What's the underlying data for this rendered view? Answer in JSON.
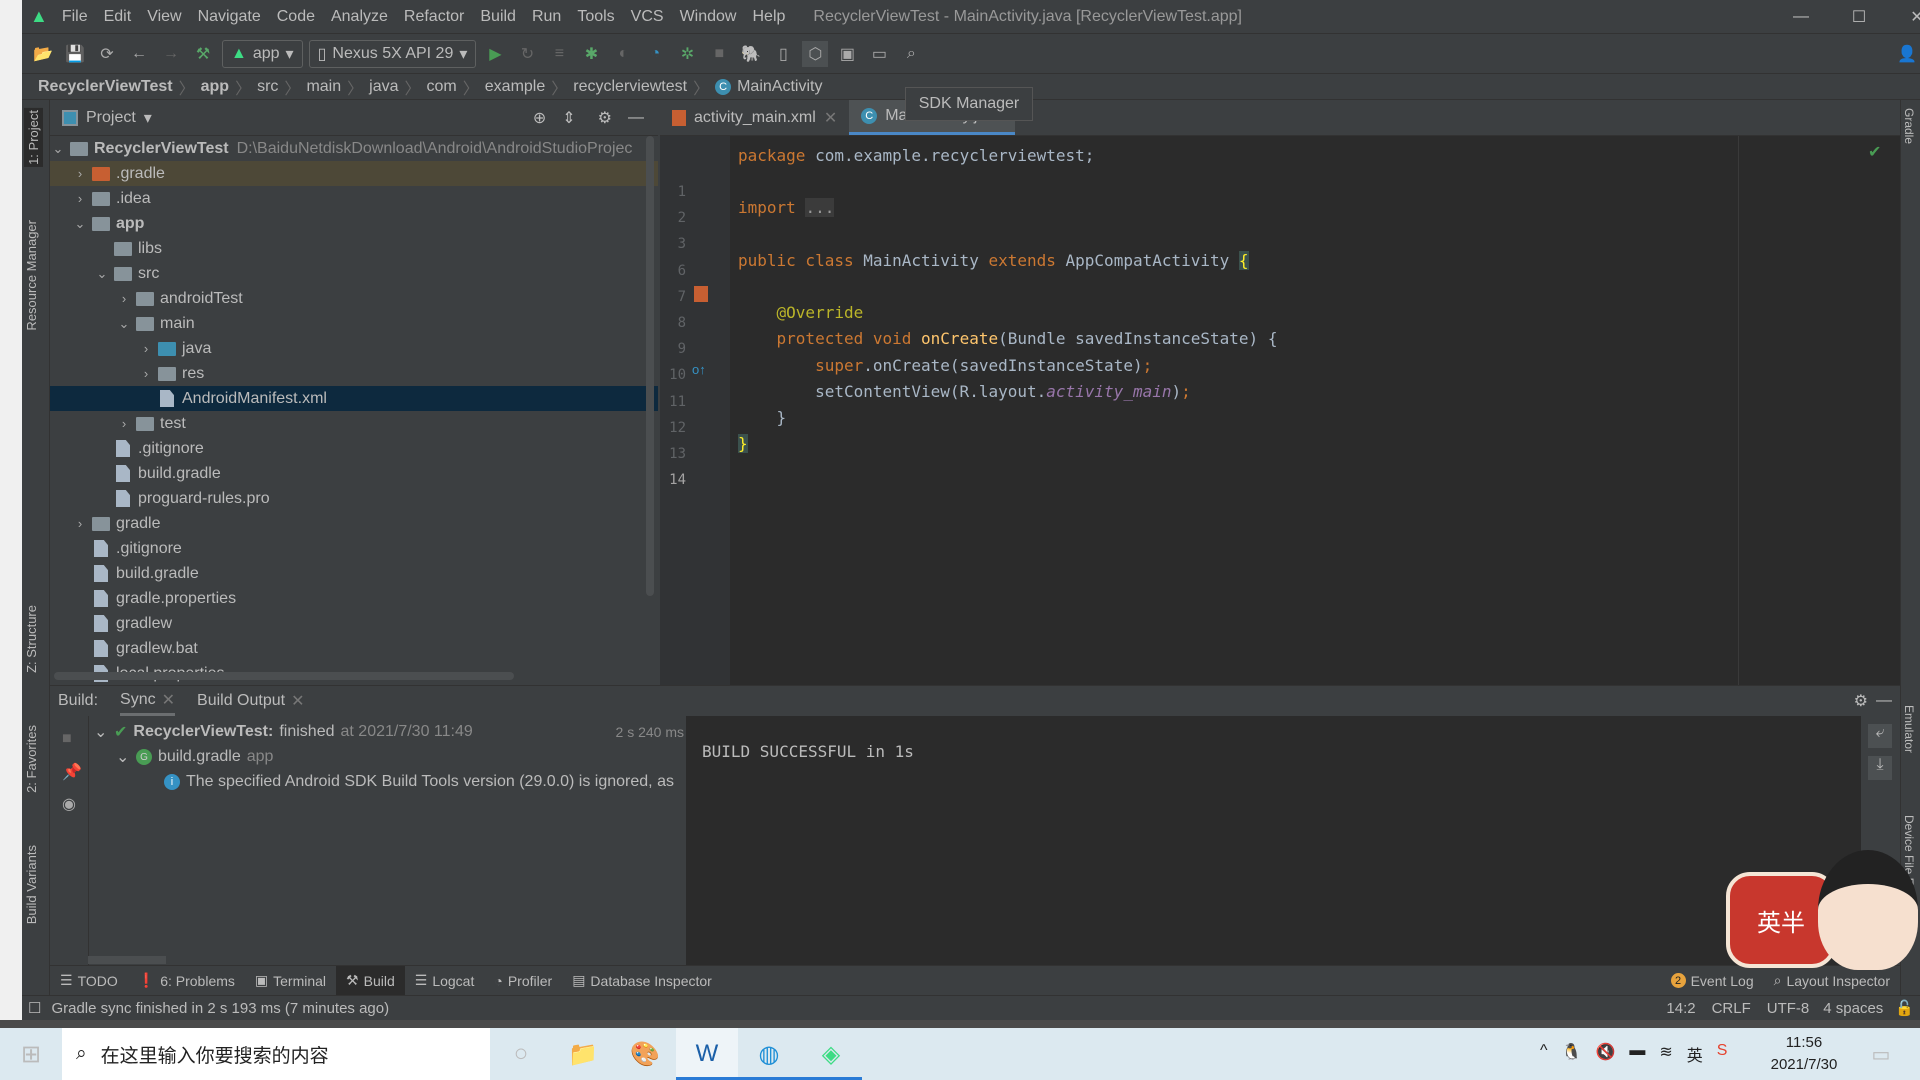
{
  "window": {
    "title": "RecyclerViewTest - MainActivity.java [RecyclerViewTest.app]",
    "menu": [
      "File",
      "Edit",
      "View",
      "Navigate",
      "Code",
      "Analyze",
      "Refactor",
      "Build",
      "Run",
      "Tools",
      "VCS",
      "Window",
      "Help"
    ]
  },
  "toolbar": {
    "config": "app",
    "device": "Nexus 5X API 29",
    "tooltip": "SDK Manager"
  },
  "breadcrumb": [
    "RecyclerViewTest",
    "app",
    "src",
    "main",
    "java",
    "com",
    "example",
    "recyclerviewtest",
    "MainActivity"
  ],
  "left_strip": [
    "1: Project",
    "Resource Manager",
    "Z: Structure",
    "2: Favorites",
    "Build Variants"
  ],
  "right_strip": [
    "Gradle",
    "Emulator",
    "Device File Explorer"
  ],
  "project": {
    "title": "Project",
    "root_path": "D:\\BaiduNetdiskDownload\\Android\\AndroidStudioProjec",
    "tree": [
      {
        "label": "RecyclerViewTest",
        "depth": 0,
        "expanded": true,
        "type": "module",
        "bold": true
      },
      {
        "label": ".gradle",
        "depth": 1,
        "expanded": false,
        "type": "folder-orange"
      },
      {
        "label": ".idea",
        "depth": 1,
        "expanded": false,
        "type": "folder"
      },
      {
        "label": "app",
        "depth": 1,
        "expanded": true,
        "type": "module",
        "bold": true
      },
      {
        "label": "libs",
        "depth": 2,
        "type": "folder"
      },
      {
        "label": "src",
        "depth": 2,
        "expanded": true,
        "type": "folder"
      },
      {
        "label": "androidTest",
        "depth": 3,
        "expanded": false,
        "type": "folder"
      },
      {
        "label": "main",
        "depth": 3,
        "expanded": true,
        "type": "folder"
      },
      {
        "label": "java",
        "depth": 4,
        "expanded": false,
        "type": "folder-blue"
      },
      {
        "label": "res",
        "depth": 4,
        "expanded": false,
        "type": "folder"
      },
      {
        "label": "AndroidManifest.xml",
        "depth": 4,
        "type": "file",
        "selected": true
      },
      {
        "label": "test",
        "depth": 3,
        "expanded": false,
        "type": "folder"
      },
      {
        "label": ".gitignore",
        "depth": 2,
        "type": "file"
      },
      {
        "label": "build.gradle",
        "depth": 2,
        "type": "file"
      },
      {
        "label": "proguard-rules.pro",
        "depth": 2,
        "type": "file"
      },
      {
        "label": "gradle",
        "depth": 1,
        "expanded": false,
        "type": "folder"
      },
      {
        "label": ".gitignore",
        "depth": 1,
        "type": "file"
      },
      {
        "label": "build.gradle",
        "depth": 1,
        "type": "file"
      },
      {
        "label": "gradle.properties",
        "depth": 1,
        "type": "file"
      },
      {
        "label": "gradlew",
        "depth": 1,
        "type": "file"
      },
      {
        "label": "gradlew.bat",
        "depth": 1,
        "type": "file"
      },
      {
        "label": "local.properties",
        "depth": 1,
        "type": "file"
      }
    ]
  },
  "editor": {
    "tabs": [
      {
        "label": "activity_main.xml"
      },
      {
        "label": "MainActivity.java",
        "active": true
      }
    ],
    "lines": [
      {
        "n": "1",
        "html": "<span class='kw'>package</span> com.example.recyclerviewtest;"
      },
      {
        "n": "2",
        "html": ""
      },
      {
        "n": "3",
        "html": "<span class='kw'>import</span> <span style='background:#3b3b3b;color:#999'>...</span>"
      },
      {
        "n": "6",
        "html": ""
      },
      {
        "n": "7",
        "html": "<span class='kw'>public class</span> MainActivity <span class='kw'>extends</span> AppCompatActivity <span style='background:#3b514d;color:#ffef28'>{</span>"
      },
      {
        "n": "8",
        "html": ""
      },
      {
        "n": "9",
        "html": "    <span class='an'>@Override</span>"
      },
      {
        "n": "10",
        "html": "    <span class='kw'>protected void</span> <span class='fn'>onCreate</span>(Bundle savedInstanceState) {"
      },
      {
        "n": "11",
        "html": "        <span class='kw'>super</span>.onCreate(savedInstanceState)<span class='kw'>;</span>"
      },
      {
        "n": "12",
        "html": "        setContentView(R.layout.<span class='it'>activity_main</span>)<span class='kw'>;</span>"
      },
      {
        "n": "13",
        "html": "    }"
      },
      {
        "n": "14",
        "html": "<span style='background:#3b514d;color:#ffef28'>}</span>"
      }
    ]
  },
  "build": {
    "label": "Build:",
    "tabs": [
      "Sync",
      "Build Output"
    ],
    "root": {
      "name": "RecyclerViewTest:",
      "status": "finished",
      "time": "at 2021/7/30 11:49",
      "duration": "2 s 240 ms"
    },
    "child": {
      "name": "build.gradle",
      "suffix": "app"
    },
    "message": "The specified Android SDK Build Tools version (29.0.0) is ignored, as",
    "console": "BUILD SUCCESSFUL in 1s"
  },
  "toolwindows": {
    "left": [
      "TODO",
      "6: Problems",
      "Terminal",
      "Build",
      "Logcat",
      "Profiler",
      "Database Inspector"
    ],
    "event_log": "Event Log",
    "event_count": "2",
    "layout_inspector": "Layout Inspector"
  },
  "status": {
    "message": "Gradle sync finished in 2 s 193 ms (7 minutes ago)",
    "position": "14:2",
    "line_sep": "CRLF",
    "encoding": "UTF-8",
    "indent": "4 spaces"
  },
  "taskbar": {
    "search_placeholder": "在这里输入你要搜索的内容",
    "time": "11:56",
    "date": "2021/7/30",
    "ime": "英",
    "sticker_text": "英半"
  }
}
